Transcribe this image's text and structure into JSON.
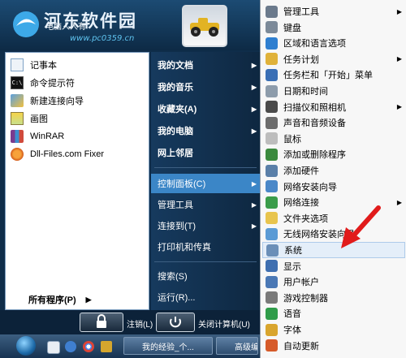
{
  "watermark": {
    "title": "河东软件园",
    "url": "www.pc0359.cn"
  },
  "user": {
    "name": "电脑人人有"
  },
  "pinned": [
    {
      "label": "记事本",
      "icon": "notepad-icon"
    },
    {
      "label": "命令提示符",
      "icon": "cmd-icon"
    },
    {
      "label": "新建连接向导",
      "icon": "connection-wizard-icon"
    },
    {
      "label": "画图",
      "icon": "paint-icon"
    },
    {
      "label": "WinRAR",
      "icon": "winrar-icon"
    },
    {
      "label": "Dll-Files.com Fixer",
      "icon": "dll-fixer-icon"
    }
  ],
  "all_programs": "所有程序(P)",
  "places": [
    {
      "label": "我的文档",
      "bold": true,
      "arrow": true
    },
    {
      "label": "我的音乐",
      "bold": true,
      "arrow": true
    },
    {
      "label": "收藏夹(A)",
      "bold": true,
      "arrow": true
    },
    {
      "label": "我的电脑",
      "bold": true,
      "arrow": true
    },
    {
      "label": "网上邻居",
      "bold": true,
      "arrow": false
    },
    {
      "label": "控制面板(C)",
      "bold": false,
      "arrow": true,
      "highlighted": true
    },
    {
      "label": "管理工具",
      "bold": false,
      "arrow": true
    },
    {
      "label": "连接到(T)",
      "bold": false,
      "arrow": true
    },
    {
      "label": "打印机和传真",
      "bold": false,
      "arrow": false
    },
    {
      "label": "搜索(S)",
      "bold": false,
      "arrow": false
    },
    {
      "label": "运行(R)...",
      "bold": false,
      "arrow": false
    }
  ],
  "bottom": {
    "logoff": "注销(L)",
    "shutdown": "关闭计算机(U)"
  },
  "taskbar": {
    "tasks": [
      {
        "label": "我的经验_个..."
      },
      {
        "label": "高级编"
      }
    ]
  },
  "control_panel": [
    {
      "label": "管理工具",
      "arrow": true,
      "icon": "admin-tools-icon",
      "color": "#6b7a8c"
    },
    {
      "label": "键盘",
      "arrow": false,
      "icon": "keyboard-icon",
      "color": "#7c8a99"
    },
    {
      "label": "区域和语言选项",
      "arrow": false,
      "icon": "globe-icon",
      "color": "#2f7fd0"
    },
    {
      "label": "任务计划",
      "arrow": true,
      "icon": "task-scheduler-icon",
      "color": "#e0b23a"
    },
    {
      "label": "任务栏和「开始」菜单",
      "arrow": false,
      "icon": "taskbar-icon",
      "color": "#3a6fb5"
    },
    {
      "label": "日期和时间",
      "arrow": false,
      "icon": "clock-icon",
      "color": "#8d9cab"
    },
    {
      "label": "扫描仪和照相机",
      "arrow": true,
      "icon": "scanner-icon",
      "color": "#4a4a4a"
    },
    {
      "label": "声音和音频设备",
      "arrow": false,
      "icon": "speaker-icon",
      "color": "#6c6c6c"
    },
    {
      "label": "鼠标",
      "arrow": false,
      "icon": "mouse-icon",
      "color": "#bdbdbd"
    },
    {
      "label": "添加或删除程序",
      "arrow": false,
      "icon": "add-remove-icon",
      "color": "#3b8a3e"
    },
    {
      "label": "添加硬件",
      "arrow": false,
      "icon": "hardware-icon",
      "color": "#5a7fa8"
    },
    {
      "label": "网络安装向导",
      "arrow": false,
      "icon": "network-wizard-icon",
      "color": "#4a88c8"
    },
    {
      "label": "网络连接",
      "arrow": true,
      "icon": "network-icon",
      "color": "#3a9c4a"
    },
    {
      "label": "文件夹选项",
      "arrow": false,
      "icon": "folder-icon",
      "color": "#e8c44d"
    },
    {
      "label": "无线网络安装向导",
      "arrow": false,
      "icon": "wireless-icon",
      "color": "#5b9bd5"
    },
    {
      "label": "系统",
      "arrow": false,
      "icon": "system-icon",
      "color": "#6b8fb8",
      "highlighted": true
    },
    {
      "label": "显示",
      "arrow": false,
      "icon": "display-icon",
      "color": "#3f6fb0"
    },
    {
      "label": "用户帐户",
      "arrow": false,
      "icon": "users-icon",
      "color": "#4a78b5"
    },
    {
      "label": "游戏控制器",
      "arrow": false,
      "icon": "gamepad-icon",
      "color": "#7a7a7a"
    },
    {
      "label": "语音",
      "arrow": false,
      "icon": "speech-icon",
      "color": "#2f9c4a"
    },
    {
      "label": "字体",
      "arrow": false,
      "icon": "fonts-icon",
      "color": "#d9a52e"
    },
    {
      "label": "自动更新",
      "arrow": false,
      "icon": "update-icon",
      "color": "#d65b2a"
    }
  ]
}
